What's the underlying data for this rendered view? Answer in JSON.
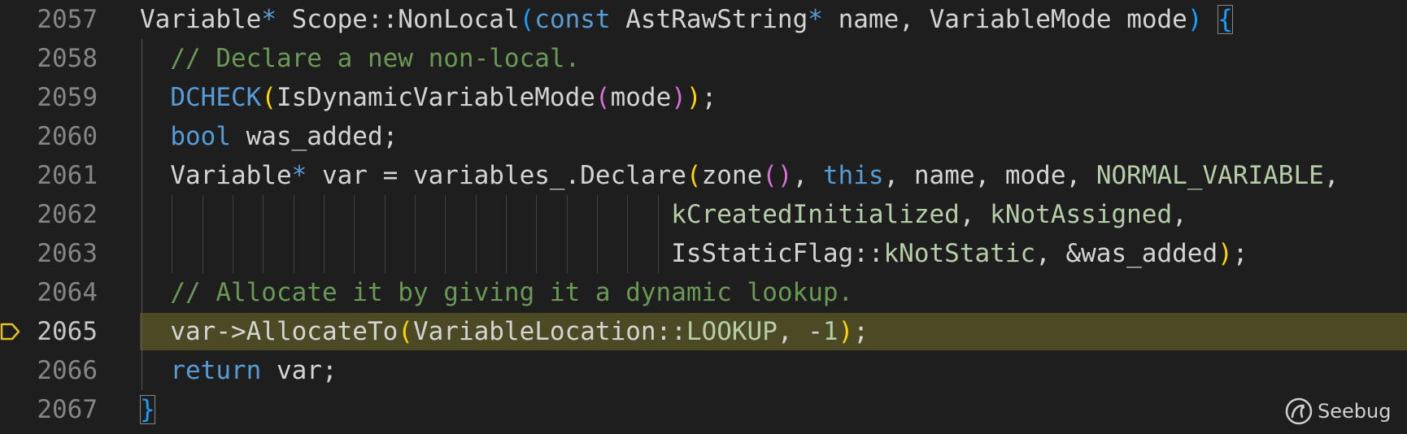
{
  "editor": {
    "current_line": "2065",
    "lines": [
      {
        "num": "2057",
        "tokens": [
          {
            "t": "Variable",
            "c": "t-type"
          },
          {
            "t": "*",
            "c": "t-op"
          },
          {
            "t": " Scope::NonLocal",
            "c": "t-fn"
          },
          {
            "t": "(",
            "c": "t-paren0"
          },
          {
            "t": "const",
            "c": "t-kw"
          },
          {
            "t": " AstRawString",
            "c": "t-type"
          },
          {
            "t": "*",
            "c": "t-op"
          },
          {
            "t": " name, VariableMode mode",
            "c": "t-plain"
          },
          {
            "t": ")",
            "c": "t-paren0"
          },
          {
            "t": " ",
            "c": "t-plain"
          },
          {
            "t": "{",
            "c": "t-paren0",
            "box": true
          }
        ]
      },
      {
        "num": "2058",
        "tokens": [
          {
            "t": "  // Declare a new non-local.",
            "c": "t-comment"
          }
        ]
      },
      {
        "num": "2059",
        "tokens": [
          {
            "t": "  ",
            "c": "t-plain"
          },
          {
            "t": "DCHECK",
            "c": "t-macro"
          },
          {
            "t": "(",
            "c": "t-paren1"
          },
          {
            "t": "IsDynamicVariableMode",
            "c": "t-fn"
          },
          {
            "t": "(",
            "c": "t-paren2"
          },
          {
            "t": "mode",
            "c": "t-plain"
          },
          {
            "t": ")",
            "c": "t-paren2"
          },
          {
            "t": ")",
            "c": "t-paren1"
          },
          {
            "t": ";",
            "c": "t-plain"
          }
        ]
      },
      {
        "num": "2060",
        "tokens": [
          {
            "t": "  ",
            "c": "t-plain"
          },
          {
            "t": "bool",
            "c": "t-kw"
          },
          {
            "t": " was_added;",
            "c": "t-plain"
          }
        ]
      },
      {
        "num": "2061",
        "tokens": [
          {
            "t": "  Variable",
            "c": "t-type"
          },
          {
            "t": "*",
            "c": "t-op"
          },
          {
            "t": " var = variables_.Declare",
            "c": "t-plain"
          },
          {
            "t": "(",
            "c": "t-paren1"
          },
          {
            "t": "zone",
            "c": "t-fn"
          },
          {
            "t": "()",
            "c": "t-paren2"
          },
          {
            "t": ", ",
            "c": "t-plain"
          },
          {
            "t": "this",
            "c": "t-kw"
          },
          {
            "t": ", name, mode, ",
            "c": "t-plain"
          },
          {
            "t": "NORMAL_VARIABLE",
            "c": "t-const"
          },
          {
            "t": ",",
            "c": "t-plain"
          }
        ]
      },
      {
        "num": "2062",
        "tokens": [
          {
            "t": "                                   ",
            "c": "t-plain"
          },
          {
            "t": "kCreatedInitialized",
            "c": "t-const"
          },
          {
            "t": ", ",
            "c": "t-plain"
          },
          {
            "t": "kNotAssigned",
            "c": "t-const"
          },
          {
            "t": ",",
            "c": "t-plain"
          }
        ]
      },
      {
        "num": "2063",
        "tokens": [
          {
            "t": "                                   IsStaticFlag::",
            "c": "t-plain"
          },
          {
            "t": "kNotStatic",
            "c": "t-const"
          },
          {
            "t": ", &was_added",
            "c": "t-plain"
          },
          {
            "t": ")",
            "c": "t-paren1"
          },
          {
            "t": ";",
            "c": "t-plain"
          }
        ]
      },
      {
        "num": "2064",
        "tokens": [
          {
            "t": "  // Allocate it by giving it a dynamic lookup.",
            "c": "t-comment"
          }
        ]
      },
      {
        "num": "2065",
        "tokens": [
          {
            "t": "  var->AllocateTo",
            "c": "t-plain"
          },
          {
            "t": "(",
            "c": "t-paren1"
          },
          {
            "t": "VariableLocation::",
            "c": "t-plain"
          },
          {
            "t": "LOOKUP",
            "c": "t-const"
          },
          {
            "t": ", -",
            "c": "t-plain"
          },
          {
            "t": "1",
            "c": "t-const"
          },
          {
            "t": ")",
            "c": "t-paren1"
          },
          {
            "t": ";",
            "c": "t-plain"
          }
        ]
      },
      {
        "num": "2066",
        "tokens": [
          {
            "t": "  ",
            "c": "t-plain"
          },
          {
            "t": "return",
            "c": "t-kw"
          },
          {
            "t": " var;",
            "c": "t-plain"
          }
        ]
      },
      {
        "num": "2067",
        "tokens": [
          {
            "t": "}",
            "c": "t-paren0",
            "box": true
          }
        ]
      }
    ]
  },
  "watermark": {
    "text": "Seebug",
    "icon": "seebug-logo-icon"
  },
  "colors": {
    "background": "#1e1e1e",
    "current_line_highlight": "#4b4a25",
    "breakpoint_marker": "#e2c02d",
    "line_number": "#858585"
  }
}
